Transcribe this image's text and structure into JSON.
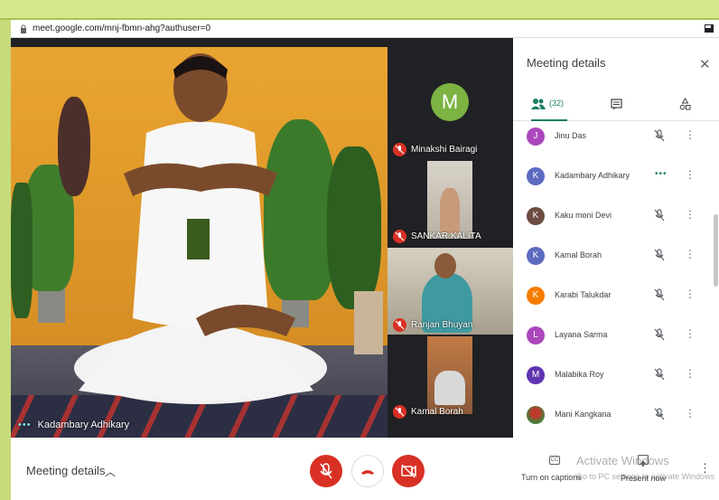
{
  "browser": {
    "url": "meet.google.com/mnj-fbmn-ahg?authuser=0"
  },
  "main_video": {
    "speaker_name": "Kadambary Adhikary"
  },
  "tiles": [
    {
      "name": "Minakshi Bairagi",
      "avatar_letter": "M",
      "avatar_color": "#7cb342",
      "muted": true
    },
    {
      "name": "SANKAR KALITA",
      "muted": true
    },
    {
      "name": "Ranjan Bhuyan",
      "muted": true
    },
    {
      "name": "Kamal Borah",
      "muted": true
    }
  ],
  "panel": {
    "title": "Meeting details",
    "people_count": "(32)",
    "participants": [
      {
        "name": "Jinu Das",
        "letter": "J",
        "color": "#ab47bc",
        "status": "muted"
      },
      {
        "name": "Kadambary Adhikary",
        "letter": "K",
        "color": "#5c6bc0",
        "status": "speaking"
      },
      {
        "name": "Kaku moni Devi",
        "letter": "K",
        "color": "#6d4c41",
        "status": "muted"
      },
      {
        "name": "Kamal Borah",
        "letter": "K",
        "color": "#5c6bc0",
        "status": "muted"
      },
      {
        "name": "Karabi Talukdar",
        "letter": "K",
        "color": "#f57c00",
        "status": "muted"
      },
      {
        "name": "Layana Sarma",
        "letter": "L",
        "color": "#ab47bc",
        "status": "muted"
      },
      {
        "name": "Malabika Roy",
        "letter": "M",
        "color": "#5e35b1",
        "status": "muted"
      },
      {
        "name": "Mani Kangkana",
        "letter": "",
        "color": "#4e7a3a",
        "status": "muted"
      }
    ]
  },
  "bottom_bar": {
    "meeting_details_label": "Meeting details",
    "captions_icon": "CC",
    "captions_label": "Turn on captions",
    "present_label": "Present now",
    "watermark_title": "Activate Windows",
    "watermark_sub": "Go to PC settings to activate Windows"
  },
  "colors": {
    "accent": "#1a7f64",
    "danger": "#d93025",
    "frame": "#c4d97a"
  }
}
